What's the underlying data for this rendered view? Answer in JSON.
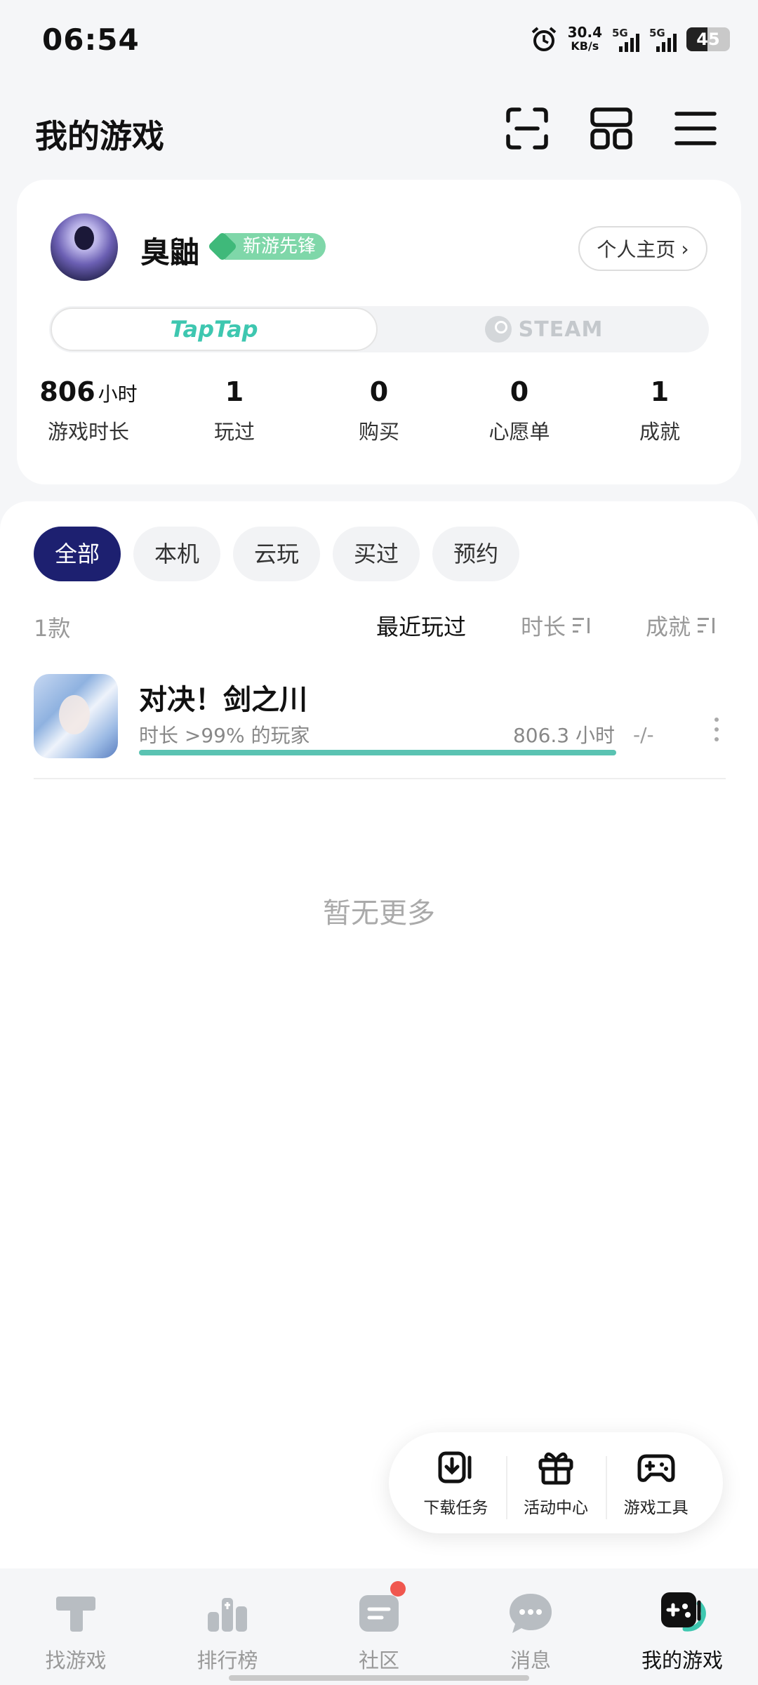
{
  "status": {
    "time": "06:54",
    "net_speed": "30.4",
    "net_unit": "KB/s",
    "sig1": "5G",
    "sig2": "5G",
    "battery": "45"
  },
  "header": {
    "title": "我的游戏"
  },
  "profile": {
    "name": "臭鼬",
    "badge": "新游先锋",
    "homepage_button": "个人主页",
    "tabs": {
      "taptap": "TapTap",
      "steam": "STEAM"
    },
    "stats": [
      {
        "value": "806",
        "unit": "小时",
        "label": "游戏时长"
      },
      {
        "value": "1",
        "label": "玩过"
      },
      {
        "value": "0",
        "label": "购买"
      },
      {
        "value": "0",
        "label": "心愿单"
      },
      {
        "value": "1",
        "label": "成就"
      }
    ]
  },
  "filters": {
    "all": "全部",
    "local": "本机",
    "cloud": "云玩",
    "bought": "买过",
    "reserved": "预约"
  },
  "list": {
    "count": "1款",
    "sort_recent": "最近玩过",
    "sort_duration": "时长",
    "sort_achievement": "成就",
    "games": [
      {
        "name": "对决！剑之川",
        "subtitle": "时长 >99% 的玩家",
        "hours": "806.3 小时",
        "achievement": "-/-",
        "progress": 1.0
      }
    ],
    "empty_text": "暂无更多"
  },
  "float_toolbar": {
    "download": "下载任务",
    "events": "活动中心",
    "tools": "游戏工具"
  },
  "bottom_nav": {
    "find": "找游戏",
    "rank": "排行榜",
    "community": "社区",
    "messages": "消息",
    "mygames": "我的游戏"
  },
  "colors": {
    "accent": "#3ec7b0",
    "chip_active": "#1d2070",
    "badge": "#7fd7a9",
    "red_dot": "#f0574f"
  }
}
